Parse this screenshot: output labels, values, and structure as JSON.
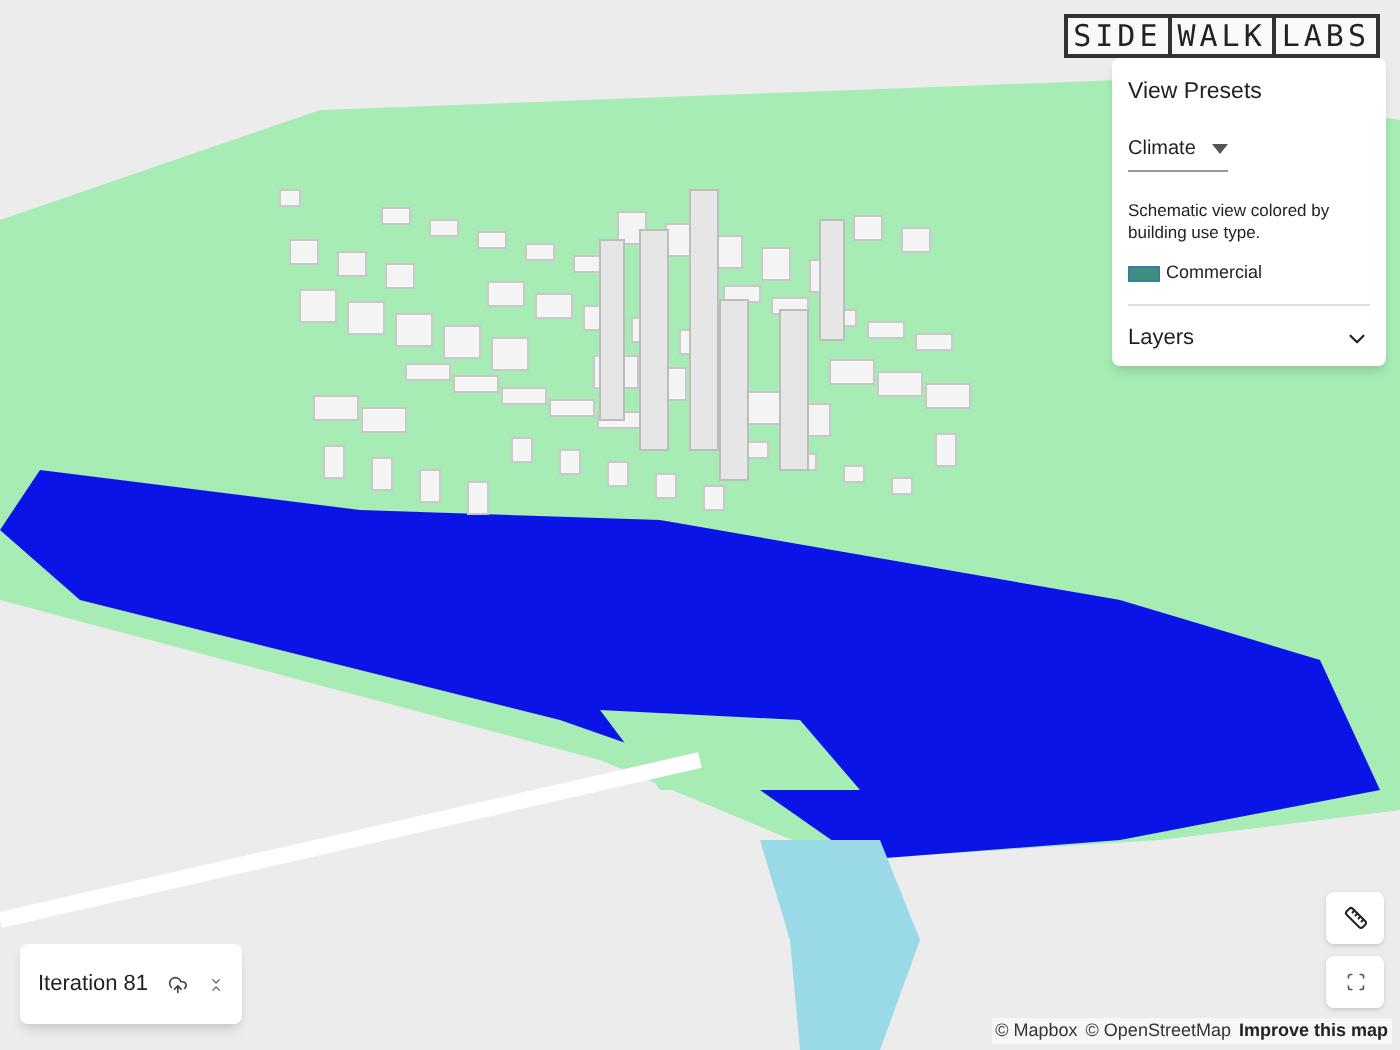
{
  "logo": {
    "parts": [
      "SIDE",
      "WALK",
      "LABS"
    ]
  },
  "view_presets": {
    "title": "View Presets",
    "dropdown": {
      "value": "Climate"
    },
    "description": "Schematic view colored by building use type.",
    "legend": [
      {
        "label": "Commercial",
        "color": "#3f8f7f"
      }
    ],
    "layers": {
      "label": "Layers",
      "expanded": false
    }
  },
  "iteration": {
    "label": "Iteration 81"
  },
  "attribution": {
    "mapbox": "© Mapbox",
    "osm": "© OpenStreetMap",
    "improve": "Improve this map"
  }
}
